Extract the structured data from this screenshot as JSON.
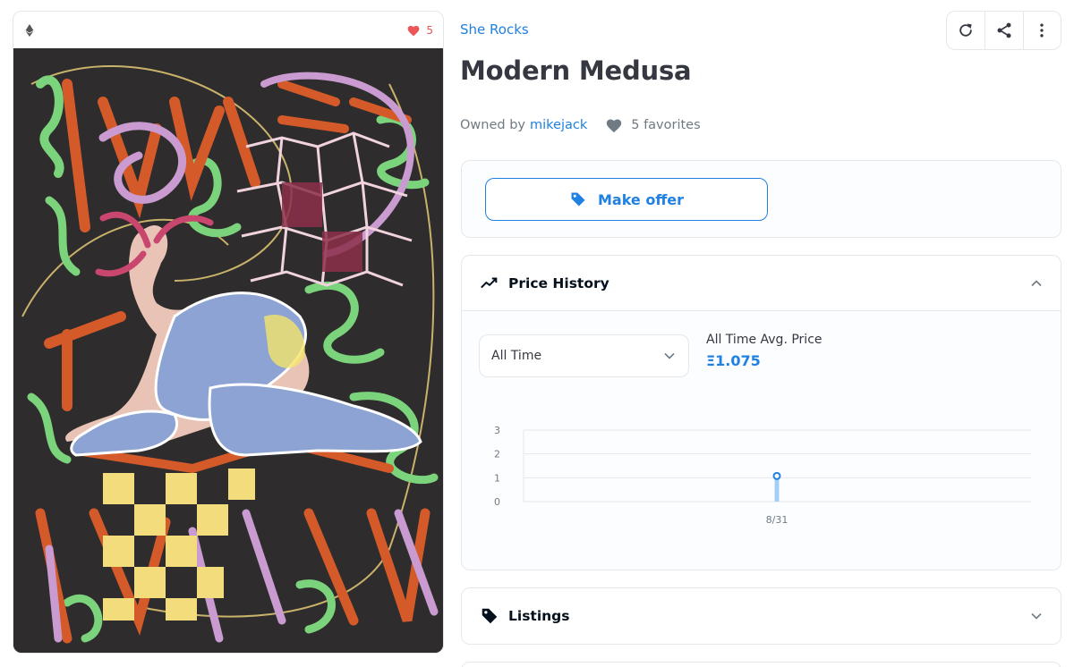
{
  "asset_card": {
    "favorite_count": "5",
    "icons": {
      "chain": "ethereum-icon",
      "favorite": "heart-icon"
    },
    "accent_heart_color": "#eb5757"
  },
  "header": {
    "collection": "She Rocks",
    "title": "Modern Medusa",
    "actions": [
      "refresh-icon",
      "share-icon",
      "more-vertical-icon"
    ]
  },
  "owner": {
    "prefix": "Owned by",
    "name": "mikejack",
    "favorites": "5 favorites"
  },
  "offer": {
    "button_label": "Make offer",
    "icon": "tag-icon"
  },
  "price_history": {
    "title": "Price History",
    "range": "All Time",
    "avg_label": "All Time Avg. Price",
    "avg_value": "Ξ1.075"
  },
  "listings": {
    "title": "Listings"
  },
  "colors": {
    "accent": "#2081e2",
    "text": "#353840",
    "muted": "#707a83",
    "border": "#e5e8eb"
  },
  "chart_data": {
    "type": "line",
    "x": [
      "8/31"
    ],
    "series": [
      {
        "values": [
          1.075
        ]
      }
    ],
    "yticks": [
      0,
      1,
      2,
      3
    ],
    "ylim": [
      0,
      3
    ],
    "grid": true
  }
}
